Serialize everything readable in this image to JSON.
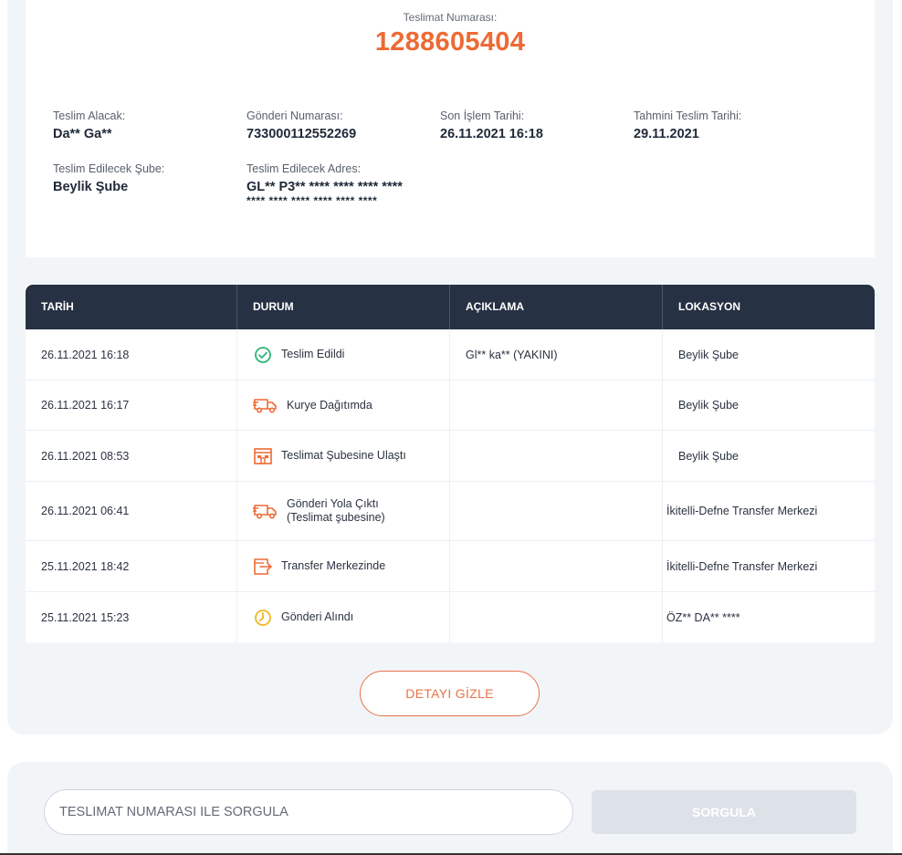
{
  "summary": {
    "tracking_label": "Teslimat Numarası:",
    "tracking_number": "1288605404",
    "fields": {
      "recipient": {
        "label": "Teslim Alacak:",
        "value": "Da** Ga**"
      },
      "shipment_no": {
        "label": "Gönderi Numarası:",
        "value": "733000112552269"
      },
      "last_action_date": {
        "label": "Son İşlem Tarihi:",
        "value": "26.11.2021 16:18"
      },
      "estimated_date": {
        "label": "Tahmini Teslim Tarihi:",
        "value": "29.11.2021"
      },
      "branch": {
        "label": "Teslim Edilecek Şube:",
        "value": "Beylik Şube"
      },
      "address": {
        "label": "Teslim Edilecek Adres:",
        "value_line1": "GL** P3** **** **** **** ****",
        "value_line2": "**** **** **** **** **** ****"
      }
    }
  },
  "table": {
    "headers": [
      "TARİH",
      "DURUM",
      "AÇIKLAMA",
      "LOKASYON"
    ],
    "rows": [
      {
        "date": "26.11.2021 16:18",
        "status": "Teslim Edildi",
        "icon": "check-circle-icon",
        "desc": "Gl** ka** (YAKINI)",
        "location": "Beylik Şube"
      },
      {
        "date": "26.11.2021 16:17",
        "status": "Kurye Dağıtımda",
        "icon": "delivery-truck-icon",
        "desc": "",
        "location": "Beylik Şube"
      },
      {
        "date": "26.11.2021 08:53",
        "status": "Teslimat Şubesine Ulaştı",
        "icon": "branch-building-icon",
        "desc": "",
        "location": "Beylik Şube"
      },
      {
        "date": "26.11.2021 06:41",
        "status": "Gönderi Yola Çıktı",
        "status_line2": "(Teslimat şubesine)",
        "icon": "delivery-truck-icon",
        "desc": "",
        "location": "İkitelli-Defne Transfer Merkezi"
      },
      {
        "date": "25.11.2021 18:42",
        "status": "Transfer Merkezinde",
        "icon": "transfer-box-icon",
        "desc": "",
        "location": "İkitelli-Defne Transfer Merkezi"
      },
      {
        "date": "25.11.2021 15:23",
        "status": "Gönderi Alındı",
        "icon": "clock-icon",
        "desc": "",
        "location": "ÖZ** DA** ****"
      }
    ]
  },
  "actions": {
    "hide_detail": "DETAYI GİZLE"
  },
  "query": {
    "placeholder": "TESLİMAT NUMARASI İLE SORGULA",
    "button": "SORGULA"
  },
  "colors": {
    "accent": "#ee6a35",
    "header_bg": "#263143",
    "success": "#2bb673",
    "warning": "#f2b722"
  }
}
